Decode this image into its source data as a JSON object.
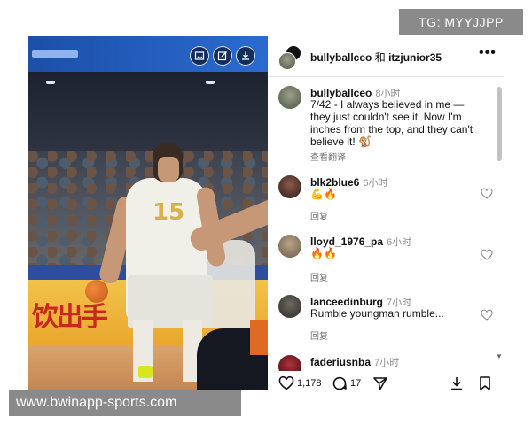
{
  "watermarks": {
    "top": "TG: MYYJJPP",
    "bottom": "www.bwinapp-sports.com"
  },
  "video": {
    "ad_text": "饮出手",
    "jersey_number": "15",
    "overlay_icons": [
      "image-icon",
      "edit-icon",
      "download-icon"
    ]
  },
  "header": {
    "user1": "bullyballceo",
    "connector": "和",
    "user2": "itzjunior35",
    "more": "•••"
  },
  "comments": [
    {
      "user": "bullyballceo",
      "time": "8小时",
      "text": "7/42 - I always believed in me — they just couldn't see it. Now I'm inches from the top, and they can't believe it! 🐒",
      "sub": "查看翻译"
    },
    {
      "user": "blk2blue6",
      "time": "6小时",
      "text": "💪🔥",
      "sub": "回复"
    },
    {
      "user": "lloyd_1976_pa",
      "time": "6小时",
      "text": "🔥🔥",
      "sub": "回复"
    },
    {
      "user": "lanceedinburg",
      "time": "7小时",
      "text": "Rumble youngman rumble...",
      "sub": "回复"
    },
    {
      "user": "faderiusnba",
      "time": "7小时",
      "text": "",
      "sub": ""
    }
  ],
  "actions": {
    "likes": "1,178",
    "comments": "17"
  },
  "colors": {
    "accent_scoreboard": "#2b6bd0",
    "ad_board": "#f2c24a",
    "muted_text": "#8e8e8e"
  }
}
